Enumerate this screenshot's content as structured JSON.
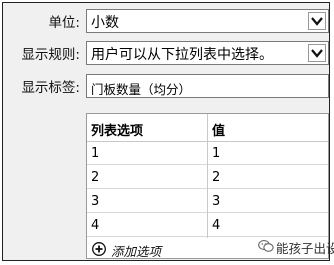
{
  "form": {
    "unit_label": "单位:",
    "unit_value": "小数",
    "display_rule_label": "显示规则:",
    "display_rule_value": "用户可以从下拉列表中选择。",
    "display_tag_label": "显示标签:",
    "display_tag_value": "门板数量（均分）"
  },
  "table": {
    "headers": [
      "列表选项",
      "值"
    ],
    "rows": [
      [
        "1",
        "1"
      ],
      [
        "2",
        "2"
      ],
      [
        "3",
        "3"
      ],
      [
        "4",
        "4"
      ]
    ],
    "add_option_label": "添加选项"
  },
  "watermark": {
    "text": "能孩子出设",
    "icon": "wechat-icon"
  }
}
